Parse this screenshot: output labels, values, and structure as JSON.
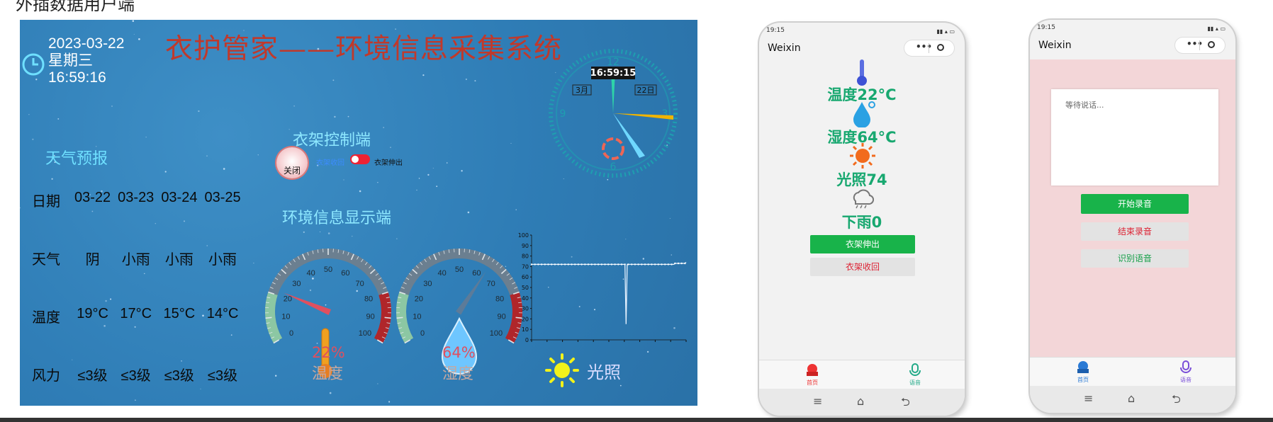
{
  "caption": "外插数据用户端",
  "dashboard": {
    "date": "2023-03-22",
    "weekday": "星期三",
    "time": "16:59:16",
    "title": "衣护管家——环境信息采集系统",
    "weather": {
      "title": "天气预报",
      "rows": [
        {
          "label": "日期",
          "values": [
            "03-22",
            "03-23",
            "03-24",
            "03-25"
          ]
        },
        {
          "label": "天气",
          "values": [
            "阴",
            "小雨",
            "小雨",
            "小雨"
          ]
        },
        {
          "label": "温度",
          "values": [
            "19°C",
            "17°C",
            "15°C",
            "14°C"
          ]
        },
        {
          "label": "风力",
          "values": [
            "≤3级",
            "≤3级",
            "≤3级",
            "≤3级"
          ]
        }
      ]
    },
    "rack": {
      "title": "衣架控制端",
      "button_label": "关闭",
      "left_label": "衣架收回",
      "right_label": "衣架伸出",
      "toggle_on": true
    },
    "env": {
      "title": "环境信息显示端",
      "temperature": {
        "value": 22,
        "display": "22%",
        "label": "温度",
        "ticks": [
          "0",
          "10",
          "20",
          "30",
          "40",
          "50",
          "60",
          "70",
          "80",
          "90",
          "100"
        ]
      },
      "humidity": {
        "value": 64,
        "display": "64%",
        "label": "湿度",
        "ticks": [
          "0",
          "10",
          "20",
          "30",
          "40",
          "50",
          "60",
          "70",
          "80",
          "90",
          "100"
        ]
      },
      "light_label": "光照"
    },
    "clock": {
      "time": "16:59:15",
      "month": "3月",
      "day": "22日",
      "numbers": [
        "12",
        "3",
        "6",
        "9"
      ]
    }
  },
  "chart_data": {
    "type": "line",
    "ylim": [
      0,
      100
    ],
    "yticks": [
      "0",
      "10",
      "20",
      "30",
      "40",
      "50",
      "60",
      "70",
      "80",
      "90",
      "100"
    ],
    "series": [
      {
        "values": [
          72,
          72,
          72,
          72,
          72,
          72,
          72,
          72,
          72,
          72,
          72,
          72,
          72,
          72,
          72,
          72,
          72,
          72,
          72,
          72,
          72,
          72,
          72,
          72,
          72,
          72,
          72,
          72,
          72,
          72,
          72,
          72,
          72,
          72,
          72,
          72,
          72,
          72,
          72,
          72,
          72,
          72,
          72,
          72,
          72,
          72,
          72,
          72,
          72,
          72,
          72,
          72,
          72,
          72,
          72,
          72,
          72,
          72,
          72,
          72,
          72,
          72,
          72,
          72,
          72,
          72,
          72,
          72,
          72,
          72,
          72,
          72,
          72,
          72,
          72,
          72,
          72,
          72,
          72,
          72,
          72,
          72,
          72,
          72,
          72,
          15,
          72,
          72,
          72,
          72,
          72,
          72,
          72,
          72,
          72,
          72,
          72,
          72,
          72,
          72,
          72,
          72,
          72,
          72,
          72,
          72,
          72,
          72,
          72,
          72,
          72,
          72,
          72,
          72,
          72,
          72,
          72,
          72,
          72,
          72,
          72,
          72,
          72,
          72,
          72,
          72,
          72,
          72,
          72,
          73,
          73,
          73,
          73,
          73,
          73,
          73,
          73,
          73,
          73,
          74
        ]
      }
    ]
  },
  "phone1": {
    "status_time": "19:15",
    "app_title": "Weixin",
    "capsule_dots": "•••",
    "temperature": "温度22°C",
    "humidity": "湿度64°C",
    "light": "光照74",
    "rain": "下雨0",
    "extend_button": "衣架伸出",
    "retract_button": "衣架收回",
    "tab_home": "首页",
    "tab_voice": "语音"
  },
  "phone2": {
    "status_time": "19:15",
    "app_title": "Weixin",
    "capsule_dots": "•••",
    "textarea_placeholder": "等待说话...",
    "start_button": "开始录音",
    "stop_button": "结束录音",
    "recognize_button": "识别语音",
    "tab_home": "首页",
    "tab_voice": "语音"
  },
  "colors": {
    "dashboard_bg": "#2f7db6",
    "title_red": "#c0392b",
    "accent_cyan": "#6fe0ff",
    "phone_green": "#18b34a",
    "phone_pink": "#f3d6d8"
  }
}
